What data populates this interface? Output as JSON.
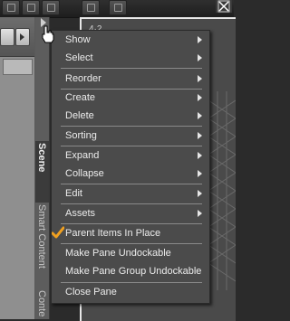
{
  "viewport": {
    "label": "4·2"
  },
  "tabs": [
    {
      "label": "Scene",
      "active": true
    },
    {
      "label": "Smart Content",
      "active": false
    },
    {
      "label": "Conte",
      "active": false
    }
  ],
  "context_menu": {
    "items": [
      {
        "label": "Show",
        "submenu": true
      },
      {
        "label": "Select",
        "submenu": true
      },
      {
        "label": "Reorder",
        "submenu": true
      },
      {
        "label": "Create",
        "submenu": true
      },
      {
        "label": "Delete",
        "submenu": true
      },
      {
        "label": "Sorting",
        "submenu": true
      },
      {
        "label": "Expand",
        "submenu": true
      },
      {
        "label": "Collapse",
        "submenu": true
      },
      {
        "label": "Edit",
        "submenu": true
      },
      {
        "label": "Assets",
        "submenu": true
      },
      {
        "label": "Parent Items In Place",
        "checked": true
      },
      {
        "label": "Make Pane Undockable"
      },
      {
        "label": "Make Pane Group Undockable"
      },
      {
        "label": "Close Pane"
      }
    ]
  },
  "icons": {
    "checkmark": "checkmark-icon",
    "cursor": "hand-pointer-icon",
    "nav_forward": "chevron-right-icon",
    "tab_menu": "triangle-right-icon"
  },
  "colors": {
    "menu_bg": "#4b4b4b",
    "menu_text": "#ececec",
    "check_orange": "#f0a020",
    "viewport_border": "#e8e8e8"
  }
}
